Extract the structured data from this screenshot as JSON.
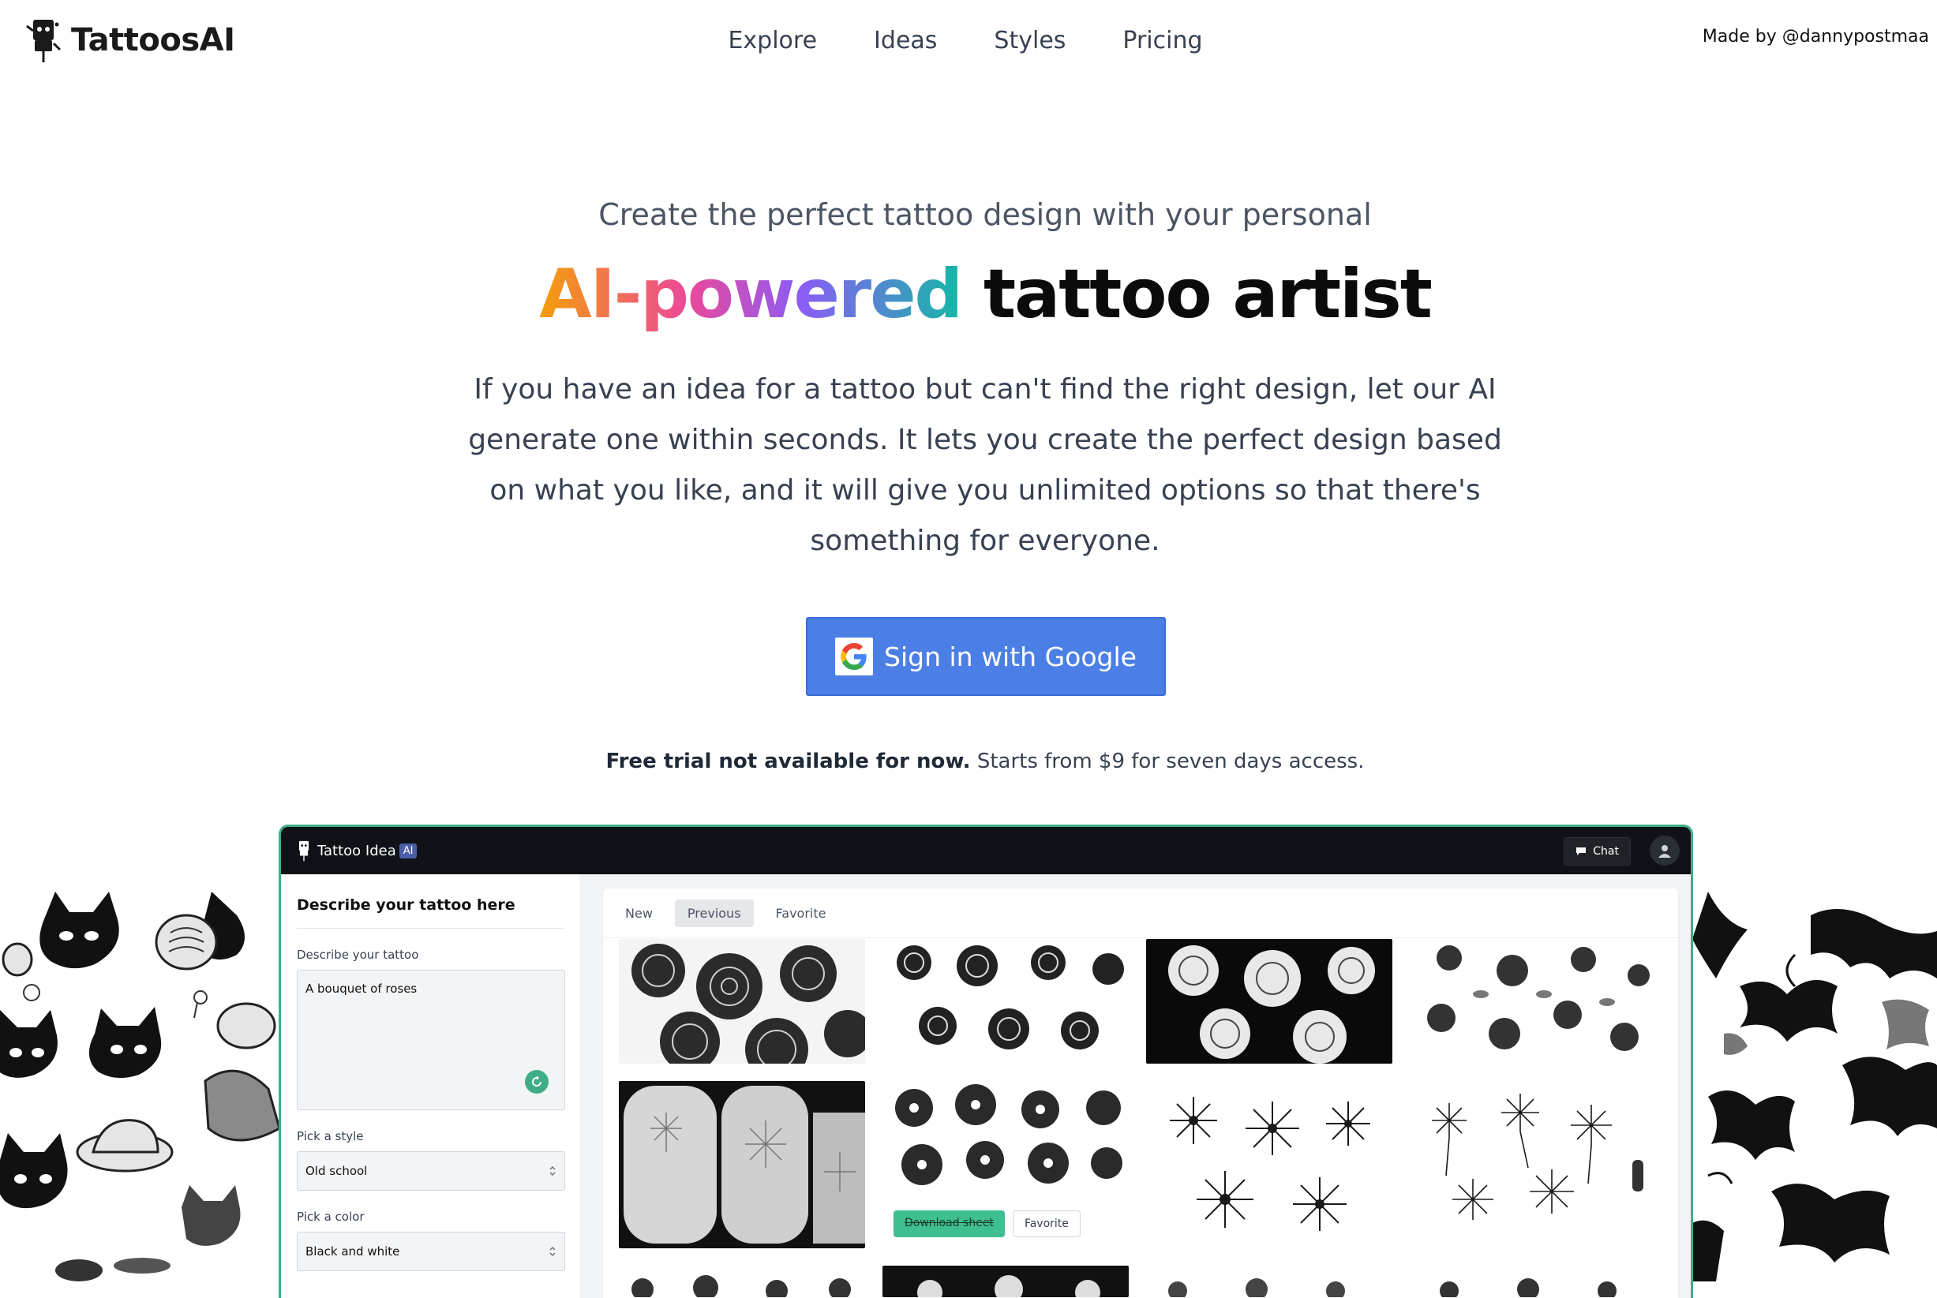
{
  "brand": {
    "name": "TattoosAI"
  },
  "nav": {
    "items": [
      "Explore",
      "Ideas",
      "Styles",
      "Pricing"
    ]
  },
  "madeby": "Made by @dannypostmaa",
  "hero": {
    "subtitle": "Create the perfect tattoo design with your personal",
    "title_highlight": "AI-powered",
    "title_rest": "tattoo artist",
    "description": "If you have an idea for a tattoo but can't find the right design, let our AI generate one within seconds. It lets you create the perfect design based on what you like, and it will give you unlimited options so that there's something for everyone."
  },
  "signin": {
    "label": "Sign in with Google"
  },
  "trial": {
    "bold": "Free trial not available for now.",
    "rest": "Starts from $9 for seven days access."
  },
  "app": {
    "title": "Tattoo Idea",
    "badge": "AI",
    "chat_label": "Chat",
    "form": {
      "heading": "Describe your tattoo here",
      "describe_label": "Describe your tattoo",
      "describe_value": "A bouquet of roses",
      "style_label": "Pick a style",
      "style_value": "Old school",
      "color_label": "Pick a color",
      "color_value": "Black and white"
    },
    "tabs": [
      "New",
      "Previous",
      "Favorite"
    ],
    "active_tab": "Previous",
    "download_label": "Download sheet",
    "favorite_label": "Favorite"
  },
  "colors": {
    "google_blue": "#4c7fe6",
    "accent_green": "#3fae88",
    "app_bar": "#0f1318",
    "gradient": [
      "#f59e0b",
      "#ec4899",
      "#8b5cf6",
      "#14b8a6"
    ]
  },
  "icons": {
    "logo": "robot-icon",
    "google": "google-g-icon",
    "chat": "chat-bubble-icon",
    "avatar": "user-icon",
    "regenerate": "refresh-icon",
    "select": "chevron-updown-icon"
  }
}
